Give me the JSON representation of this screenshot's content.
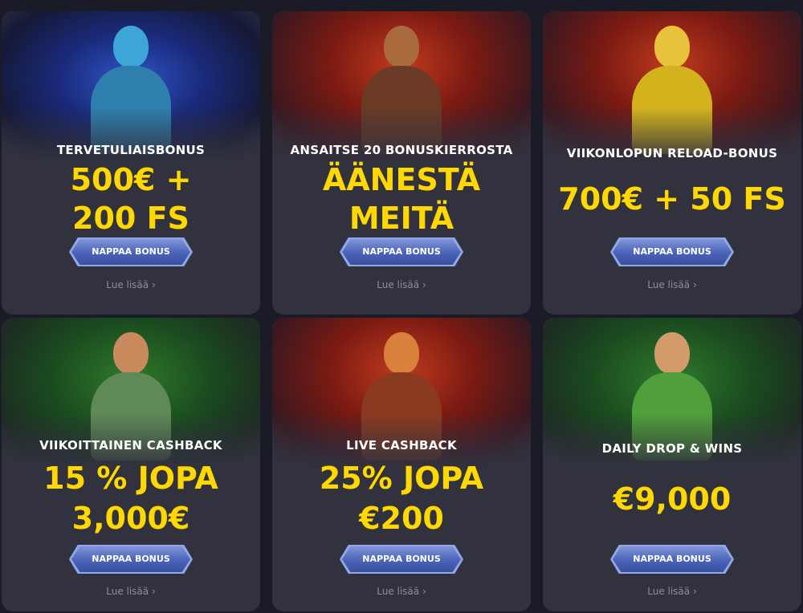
{
  "cards": [
    {
      "title": "TERVETULIAISBONUS",
      "headline_1": "500€ +",
      "headline_2": "200 FS",
      "button": "NAPPAA BONUS",
      "more": "Lue lisää ›"
    },
    {
      "title": "ANSAITSE 20 BONUSKIERROSTA",
      "headline_1": "ÄÄNESTÄ",
      "headline_2": "MEITÄ",
      "button": "NAPPAA BONUS",
      "more": "Lue lisää ›"
    },
    {
      "title": "VIIKONLOPUN RELOAD-BONUS",
      "headline_1": "700€ + 50 FS",
      "button": "NAPPAA BONUS",
      "more": "Lue lisää ›"
    },
    {
      "title": "VIIKOITTAINEN CASHBACK",
      "headline_1": "15 % JOPA",
      "headline_2": "3,000€",
      "button": "NAPPAA BONUS",
      "more": "Lue lisää ›"
    },
    {
      "title": "LIVE CASHBACK",
      "headline_1": "25% JOPA",
      "headline_2": "€200",
      "button": "NAPPAA BONUS",
      "more": "Lue lisää ›"
    },
    {
      "title": "DAILY DROP & WINS",
      "headline_1": "€9,000",
      "button": "NAPPAA BONUS",
      "more": "Lue lisää ›"
    }
  ],
  "colors": {
    "card_bg": "#32323f",
    "headline": "#ffd800",
    "button": "#4a62b8"
  },
  "icons": [
    "chevron-right-icon"
  ]
}
